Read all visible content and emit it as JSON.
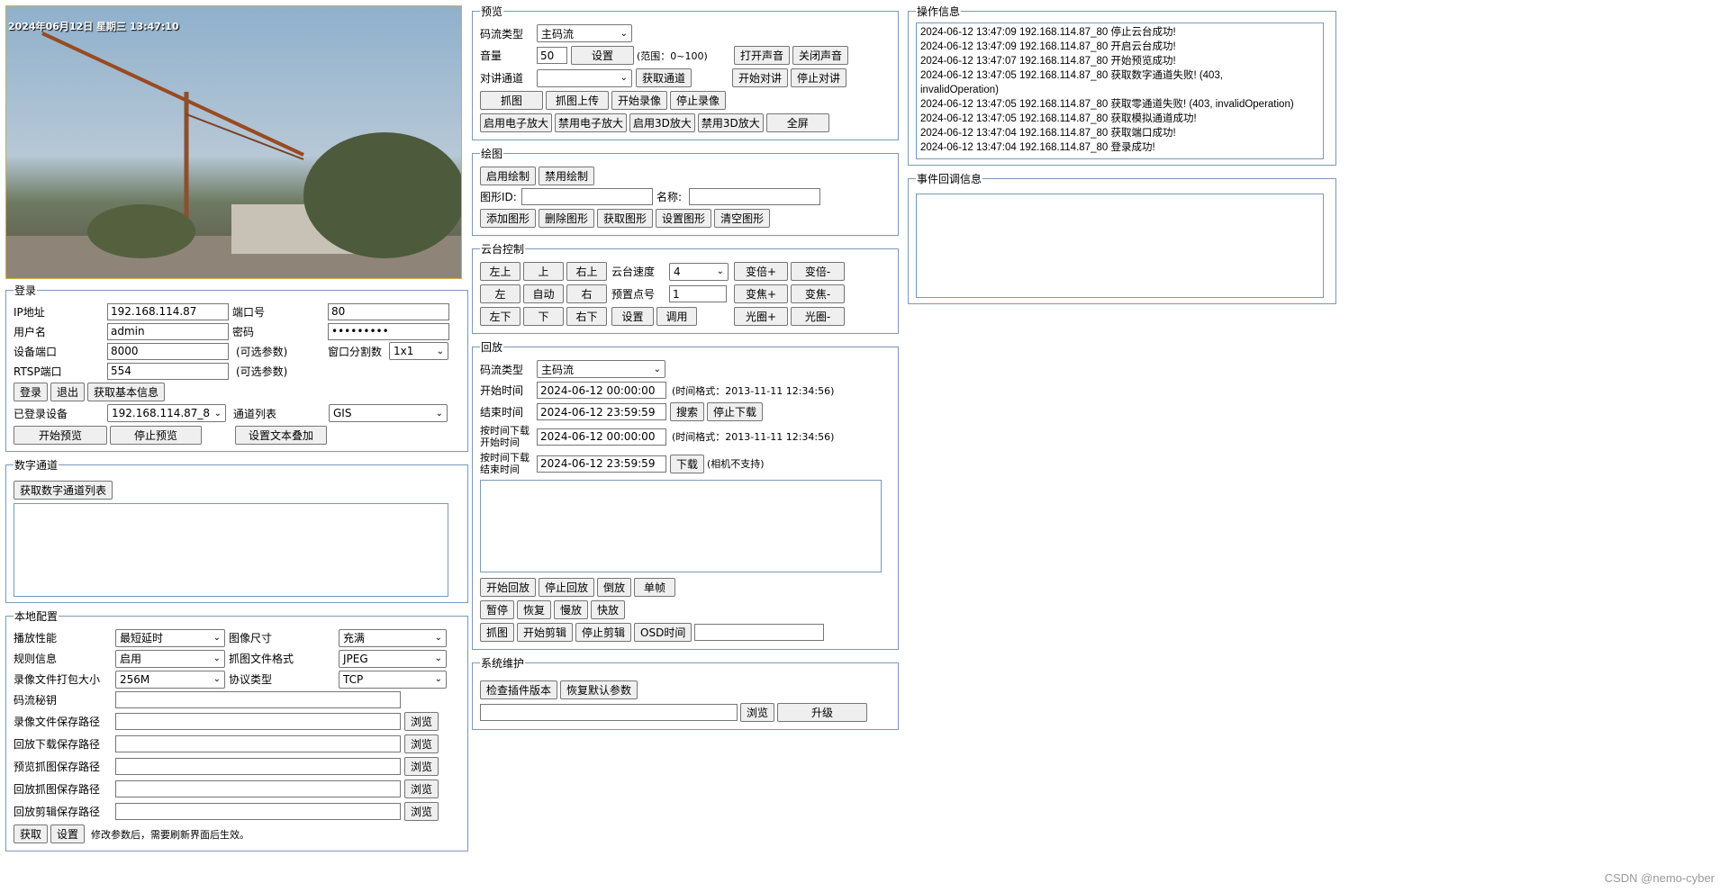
{
  "video": {
    "osd_text": "2024年06月12日 星期三 13:47:10"
  },
  "login": {
    "legend": "登录",
    "ip_label": "IP地址",
    "ip_value": "192.168.114.87",
    "port_label": "端口号",
    "port_value": "80",
    "user_label": "用户名",
    "user_value": "admin",
    "pass_label": "密码",
    "pass_value": "•••••••••",
    "dev_port_label": "设备端口",
    "dev_port_value": "8000",
    "optional1": "(可选参数)",
    "split_label": "窗口分割数",
    "split_value": "1x1",
    "rtsp_label": "RTSP端口",
    "rtsp_value": "554",
    "optional2": "(可选参数)",
    "login_btn": "登录",
    "logout_btn": "退出",
    "basic_info_btn": "获取基本信息",
    "logged_label": "已登录设备",
    "logged_value": "192.168.114.87_8",
    "channel_label": "通道列表",
    "channel_value": "GIS",
    "start_preview_btn": "开始预览",
    "stop_preview_btn": "停止预览",
    "text_overlay_btn": "设置文本叠加"
  },
  "digital": {
    "legend": "数字通道",
    "get_list_btn": "获取数字通道列表"
  },
  "local": {
    "legend": "本地配置",
    "play_perf_label": "播放性能",
    "play_perf_value": "最短延时",
    "img_size_label": "图像尺寸",
    "img_size_value": "充满",
    "rule_label": "规则信息",
    "rule_value": "启用",
    "snap_fmt_label": "抓图文件格式",
    "snap_fmt_value": "JPEG",
    "pack_label": "录像文件打包大小",
    "pack_value": "256M",
    "proto_label": "协议类型",
    "proto_value": "TCP",
    "secret_label": "码流秘钥",
    "paths": [
      "录像文件保存路径",
      "回放下载保存路径",
      "预览抓图保存路径",
      "回放抓图保存路径",
      "回放剪辑保存路径"
    ],
    "browse_btn": "浏览",
    "get_btn": "获取",
    "set_btn": "设置",
    "note": "修改参数后，需要刷新界面后生效。"
  },
  "preview": {
    "legend": "预览",
    "stream_label": "码流类型",
    "stream_value": "主码流",
    "volume_label": "音量",
    "volume_value": "50",
    "set_btn": "设置",
    "range": "(范围：0~100)",
    "open_sound_btn": "打开声音",
    "close_sound_btn": "关闭声音",
    "talk_label": "对讲通道",
    "get_channel_btn": "获取通道",
    "start_talk_btn": "开始对讲",
    "stop_talk_btn": "停止对讲",
    "snap_btn": "抓图",
    "snap_upload_btn": "抓图上传",
    "start_rec_btn": "开始录像",
    "stop_rec_btn": "停止录像",
    "e_zoom_on_btn": "启用电子放大",
    "e_zoom_off_btn": "禁用电子放大",
    "zoom3d_on_btn": "启用3D放大",
    "zoom3d_off_btn": "禁用3D放大",
    "fullscreen_btn": "全屏"
  },
  "draw": {
    "legend": "绘图",
    "enable_btn": "启用绘制",
    "disable_btn": "禁用绘制",
    "shape_id_label": "图形ID:",
    "name_label": "名称:",
    "add_btn": "添加图形",
    "del_btn": "删除图形",
    "get_btn": "获取图形",
    "set_btn": "设置图形",
    "clear_btn": "清空图形"
  },
  "ptz": {
    "legend": "云台控制",
    "up_left": "左上",
    "up": "上",
    "up_right": "右上",
    "left": "左",
    "auto": "自动",
    "right": "右",
    "down_left": "左下",
    "down": "下",
    "down_right": "右下",
    "speed_label": "云台速度",
    "speed_value": "4",
    "preset_label": "预置点号",
    "preset_value": "1",
    "set_btn": "设置",
    "call_btn": "调用",
    "zoom_in": "变倍+",
    "zoom_out": "变倍-",
    "focus_in": "变焦+",
    "focus_out": "变焦-",
    "iris_in": "光圈+",
    "iris_out": "光圈-"
  },
  "playback": {
    "legend": "回放",
    "stream_label": "码流类型",
    "stream_value": "主码流",
    "start_label": "开始时间",
    "start_value": "2024-06-12 00:00:00",
    "fmt_hint": "(时间格式：2013-11-11 12:34:56)",
    "end_label": "结束时间",
    "end_value": "2024-06-12 23:59:59",
    "search_btn": "搜索",
    "stop_dl_btn": "停止下载",
    "dl_start_label1": "按时间下载",
    "dl_start_label2": "开始时间",
    "dl_start_value": "2024-06-12 00:00:00",
    "fmt_hint2": "(时间格式：2013-11-11 12:34:56)",
    "dl_end_label1": "按时间下载",
    "dl_end_label2": "结束时间",
    "dl_end_value": "2024-06-12 23:59:59",
    "download_btn": "下载",
    "not_supported": "(相机不支持)",
    "start_pb_btn": "开始回放",
    "stop_pb_btn": "停止回放",
    "reverse_btn": "倒放",
    "single_btn": "单帧",
    "pause_btn": "暂停",
    "resume_btn": "恢复",
    "slow_btn": "慢放",
    "fast_btn": "快放",
    "snap_btn": "抓图",
    "start_clip_btn": "开始剪辑",
    "stop_clip_btn": "停止剪辑",
    "osd_btn": "OSD时间"
  },
  "maint": {
    "legend": "系统维护",
    "check_plugin_btn": "检查插件版本",
    "restore_btn": "恢复默认参数",
    "browse_btn": "浏览",
    "upgrade_btn": "升级"
  },
  "oplog": {
    "legend": "操作信息",
    "lines": [
      "2024-06-12 13:47:09 192.168.114.87_80 停止云台成功!",
      "2024-06-12 13:47:09 192.168.114.87_80 开启云台成功!",
      "2024-06-12 13:47:07 192.168.114.87_80 开始预览成功!",
      "2024-06-12 13:47:05 192.168.114.87_80 获取数字通道失败! (403,",
      "invalidOperation)",
      "2024-06-12 13:47:05 192.168.114.87_80 获取零通道失败! (403, invalidOperation)",
      "2024-06-12 13:47:05 192.168.114.87_80 获取模拟通道成功!",
      "2024-06-12 13:47:04 192.168.114.87_80 获取端口成功!",
      "2024-06-12 13:47:04 192.168.114.87_80 登录成功!"
    ]
  },
  "events": {
    "legend": "事件回调信息"
  },
  "watermark": "CSDN @nemo-cyber"
}
